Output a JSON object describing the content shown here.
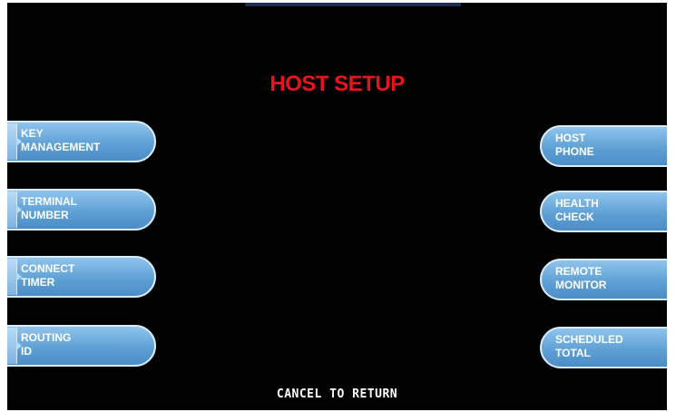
{
  "screen": {
    "title": "HOST SETUP",
    "footer": "CANCEL TO RETURN",
    "colors": {
      "background": "#000000",
      "title": "#e8141b",
      "button": "#5fa1d6",
      "button_text": "#ffffff"
    }
  },
  "left_buttons": [
    {
      "line1": "KEY",
      "line2": "MANAGEMENT"
    },
    {
      "line1": "TERMINAL",
      "line2": "NUMBER"
    },
    {
      "line1": "CONNECT",
      "line2": "TIMER"
    },
    {
      "line1": "ROUTING",
      "line2": "ID"
    }
  ],
  "right_buttons": [
    {
      "line1": "HOST",
      "line2": "PHONE"
    },
    {
      "line1": "HEALTH",
      "line2": "CHECK"
    },
    {
      "line1": "REMOTE",
      "line2": "MONITOR"
    },
    {
      "line1": "SCHEDULED",
      "line2": "TOTAL"
    }
  ]
}
